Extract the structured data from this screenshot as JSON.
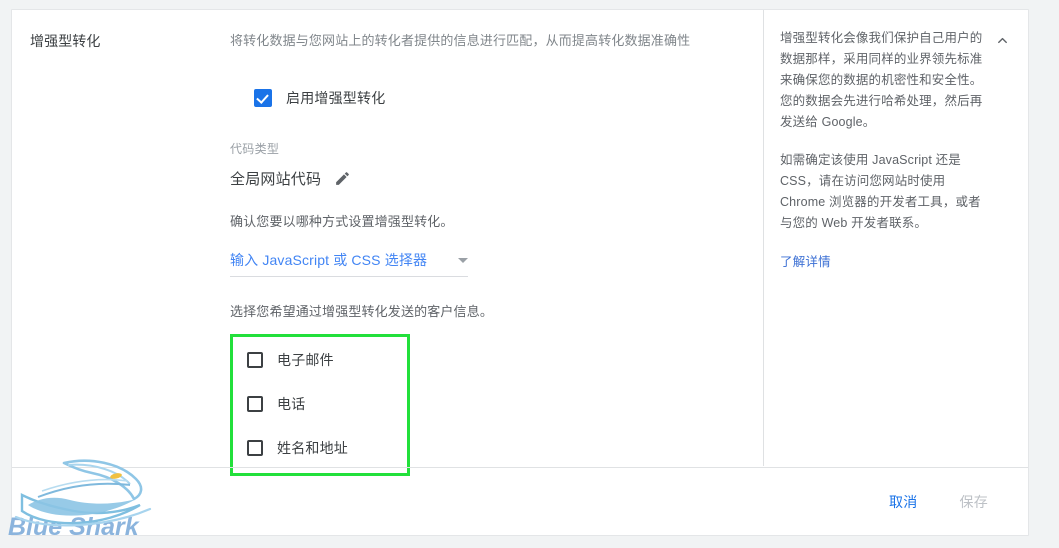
{
  "section": {
    "title": "增强型转化",
    "lead": "将转化数据与您网站上的转化者提供的信息进行匹配，从而提高转化数据准确性"
  },
  "enable": {
    "label": "启用增强型转化",
    "checked": true,
    "accent_color": "#1a73e8"
  },
  "code_type": {
    "label": "代码类型",
    "value": "全局网站代码",
    "edit_icon": "pencil-icon"
  },
  "setup": {
    "hint": "确认您要以哪种方式设置增强型转化。",
    "selector_value": "输入 JavaScript 或 CSS 选择器",
    "caret_icon": "chevron-down-icon"
  },
  "customer_info": {
    "prompt": "选择您希望通过增强型转化发送的客户信息。",
    "highlight_color": "#22e03b",
    "options": [
      {
        "label": "电子邮件",
        "checked": false
      },
      {
        "label": "电话",
        "checked": false
      },
      {
        "label": "姓名和地址",
        "checked": false
      }
    ]
  },
  "aside": {
    "collapse_icon": "chevron-up-icon",
    "paragraphs": [
      "增强型转化会像我们保护自己用户的数据那样，采用同样的业界领先标准来确保您的数据的机密性和安全性。您的数据会先进行哈希处理，然后再发送给 Google。",
      "如需确定该使用 JavaScript 还是 CSS，请在访问您网站时使用 Chrome 浏览器的开发者工具，或者与您的 Web 开发者联系。"
    ],
    "link": "了解详情"
  },
  "footer": {
    "cancel_label": "取消",
    "save_label": "保存",
    "cancel_color": "#1a73e8",
    "save_color": "#bdc1c6"
  },
  "watermark": {
    "text": "Blue Shark",
    "color": "#8bb4dd"
  }
}
